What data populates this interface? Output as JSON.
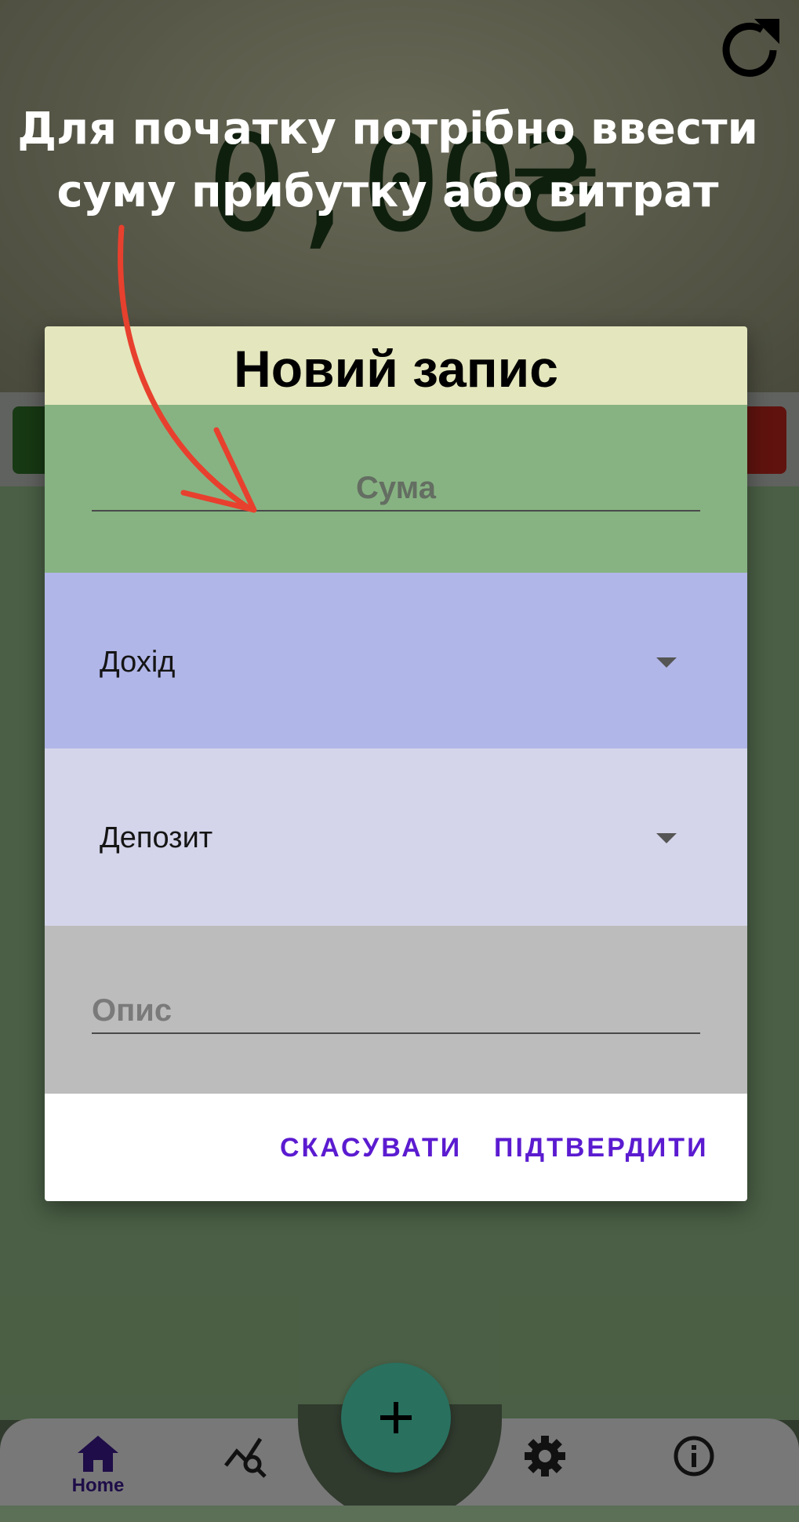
{
  "background": {
    "balance": "0,00₴",
    "nav": {
      "home_label": "Home"
    },
    "fab_symbol": "+"
  },
  "tutorial": {
    "hint_line1": "Для початку потрібно ввести",
    "hint_line2": "суму прибутку або витрат"
  },
  "dialog": {
    "title": "Новий запис",
    "amount_placeholder": "Сума",
    "type_value": "Дохід",
    "account_value": "Депозит",
    "description_placeholder": "Опис",
    "cancel_label": "СКАСУВАТИ",
    "confirm_label": "ПІДТВЕРДИТИ"
  },
  "colors": {
    "accent": "#5b1bd0",
    "nav_active": "#3b1a8a",
    "arrow": "#e8402e"
  },
  "icons": [
    "refresh-icon",
    "home-icon",
    "analytics-icon",
    "settings-icon",
    "info-icon",
    "plus-icon",
    "dropdown-caret-icon"
  ]
}
